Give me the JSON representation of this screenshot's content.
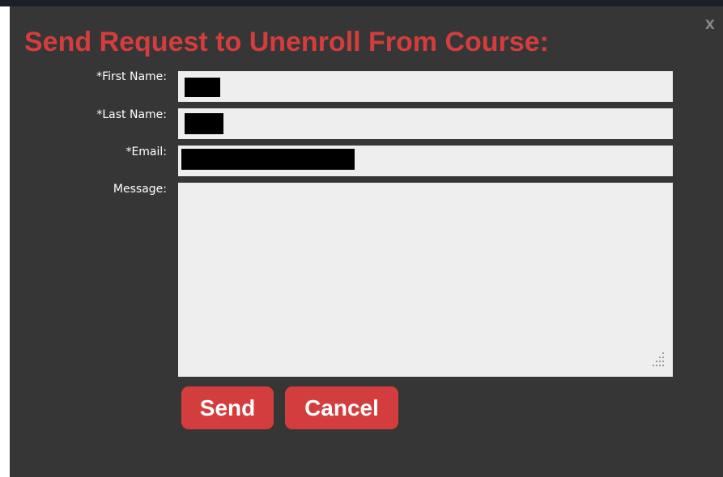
{
  "dialog": {
    "title": "Send Request to Unenroll From Course:",
    "close_label": "x",
    "accent_color": "#d43d3d",
    "background_color": "#363636"
  },
  "form": {
    "first_name": {
      "label": "*First Name:",
      "value": ""
    },
    "last_name": {
      "label": "*Last Name:",
      "value": ""
    },
    "email": {
      "label": "*Email:",
      "value": ""
    },
    "message": {
      "label": "Message:",
      "value": ""
    }
  },
  "buttons": {
    "send_label": "Send",
    "cancel_label": "Cancel"
  },
  "icons": {
    "close": "close-icon",
    "resize": "resize-grip-icon"
  }
}
